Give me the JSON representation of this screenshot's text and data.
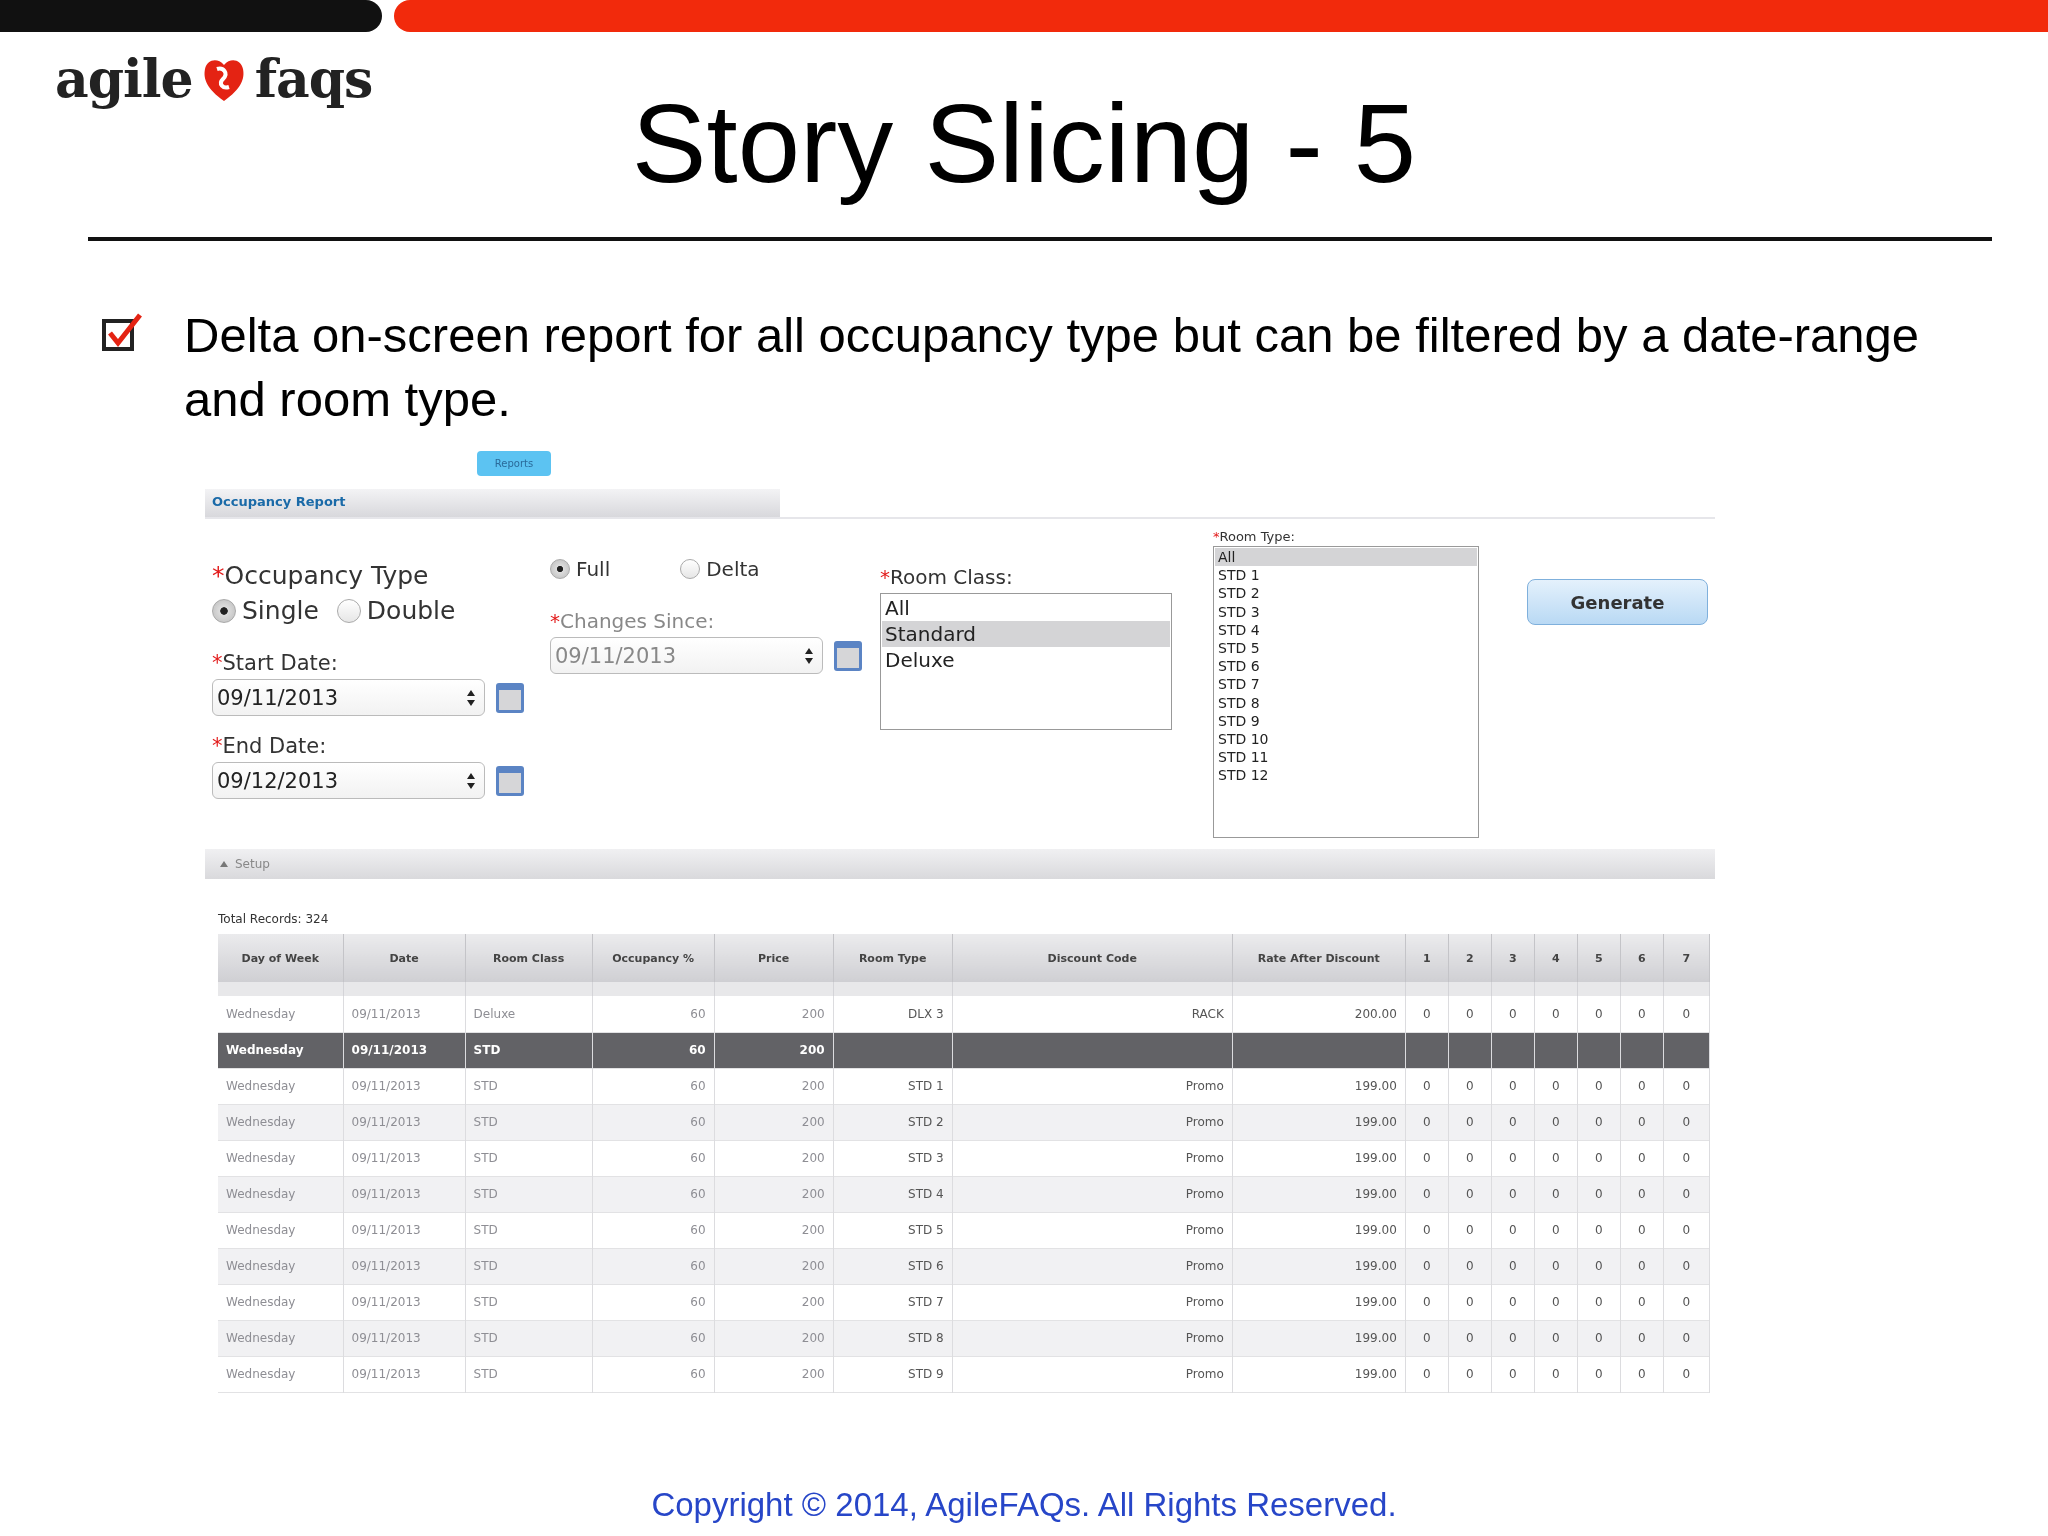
{
  "logo": {
    "left": "agile",
    "right": "faqs"
  },
  "title": "Story Slicing - 5",
  "bullets": [
    {
      "checked": true,
      "text": "Delta on-screen report for all occupancy type but can be filtered by a date-range and room type."
    }
  ],
  "app": {
    "nav_tab": {
      "label": "Reports",
      "selected": true
    },
    "panel_title": "Occupancy Report",
    "occupancy_type": {
      "required_mark": "*",
      "label": "Occupancy Type",
      "options": [
        {
          "label": "Single",
          "selected": true
        },
        {
          "label": "Double",
          "selected": false
        }
      ]
    },
    "report_mode": {
      "options": [
        {
          "label": "Full",
          "selected": true
        },
        {
          "label": "Delta",
          "selected": false
        }
      ]
    },
    "start_date": {
      "required_mark": "*",
      "label": "Start Date:",
      "value": "09/11/2013"
    },
    "end_date": {
      "required_mark": "*",
      "label": "End Date:",
      "value": "09/12/2013"
    },
    "changes_since": {
      "required_mark": "*",
      "label": "Changes Since:",
      "value": "09/11/2013",
      "disabled": true
    },
    "room_class": {
      "required_mark": "*",
      "label": "Room Class:",
      "options": [
        {
          "label": "All",
          "selected": false
        },
        {
          "label": "Standard",
          "selected": true
        },
        {
          "label": "Deluxe",
          "selected": false
        }
      ]
    },
    "room_type": {
      "required_mark": "*",
      "label": "Room Type:",
      "options": [
        {
          "label": "All",
          "selected": true
        },
        {
          "label": "STD 1",
          "selected": false
        },
        {
          "label": "STD 2",
          "selected": false
        },
        {
          "label": "STD 3",
          "selected": false
        },
        {
          "label": "STD 4",
          "selected": false
        },
        {
          "label": "STD 5",
          "selected": false
        },
        {
          "label": "STD 6",
          "selected": false
        },
        {
          "label": "STD 7",
          "selected": false
        },
        {
          "label": "STD 8",
          "selected": false
        },
        {
          "label": "STD 9",
          "selected": false
        },
        {
          "label": "STD 10",
          "selected": false
        },
        {
          "label": "STD 11",
          "selected": false
        },
        {
          "label": "STD 12",
          "selected": false
        }
      ]
    },
    "generate_button": "Generate",
    "setup": {
      "label": "Setup",
      "expanded": true
    },
    "total_records": "Total Records: 324",
    "table": {
      "columns": [
        "Day of Week",
        "Date",
        "Room Class",
        "Occupancy %",
        "Price",
        "Room Type",
        "Discount Code",
        "Rate After Discount",
        "1",
        "2",
        "3",
        "4",
        "5",
        "6",
        "7"
      ],
      "rows": [
        {
          "selected": false,
          "cells": [
            "Wednesday",
            "09/11/2013",
            "Deluxe",
            "60",
            "200",
            "DLX 3",
            "RACK",
            "200.00",
            "0",
            "0",
            "0",
            "0",
            "0",
            "0",
            "0"
          ]
        },
        {
          "selected": true,
          "cells": [
            "Wednesday",
            "09/11/2013",
            "STD",
            "60",
            "200"
          ]
        },
        {
          "selected": false,
          "cells": [
            "Wednesday",
            "09/11/2013",
            "STD",
            "60",
            "200",
            "STD 1",
            "Promo",
            "199.00",
            "0",
            "0",
            "0",
            "0",
            "0",
            "0",
            "0"
          ]
        },
        {
          "selected": false,
          "cells": [
            "Wednesday",
            "09/11/2013",
            "STD",
            "60",
            "200",
            "STD 2",
            "Promo",
            "199.00",
            "0",
            "0",
            "0",
            "0",
            "0",
            "0",
            "0"
          ]
        },
        {
          "selected": false,
          "cells": [
            "Wednesday",
            "09/11/2013",
            "STD",
            "60",
            "200",
            "STD 3",
            "Promo",
            "199.00",
            "0",
            "0",
            "0",
            "0",
            "0",
            "0",
            "0"
          ]
        },
        {
          "selected": false,
          "cells": [
            "Wednesday",
            "09/11/2013",
            "STD",
            "60",
            "200",
            "STD 4",
            "Promo",
            "199.00",
            "0",
            "0",
            "0",
            "0",
            "0",
            "0",
            "0"
          ]
        },
        {
          "selected": false,
          "cells": [
            "Wednesday",
            "09/11/2013",
            "STD",
            "60",
            "200",
            "STD 5",
            "Promo",
            "199.00",
            "0",
            "0",
            "0",
            "0",
            "0",
            "0",
            "0"
          ]
        },
        {
          "selected": false,
          "cells": [
            "Wednesday",
            "09/11/2013",
            "STD",
            "60",
            "200",
            "STD 6",
            "Promo",
            "199.00",
            "0",
            "0",
            "0",
            "0",
            "0",
            "0",
            "0"
          ]
        },
        {
          "selected": false,
          "cells": [
            "Wednesday",
            "09/11/2013",
            "STD",
            "60",
            "200",
            "STD 7",
            "Promo",
            "199.00",
            "0",
            "0",
            "0",
            "0",
            "0",
            "0",
            "0"
          ]
        },
        {
          "selected": false,
          "cells": [
            "Wednesday",
            "09/11/2013",
            "STD",
            "60",
            "200",
            "STD 8",
            "Promo",
            "199.00",
            "0",
            "0",
            "0",
            "0",
            "0",
            "0",
            "0"
          ]
        },
        {
          "selected": false,
          "cells": [
            "Wednesday",
            "09/11/2013",
            "STD",
            "60",
            "200",
            "STD 9",
            "Promo",
            "199.00",
            "0",
            "0",
            "0",
            "0",
            "0",
            "0",
            "0"
          ]
        }
      ]
    }
  },
  "copyright": "Copyright © 2014, AgileFAQs. All Rights Reserved."
}
